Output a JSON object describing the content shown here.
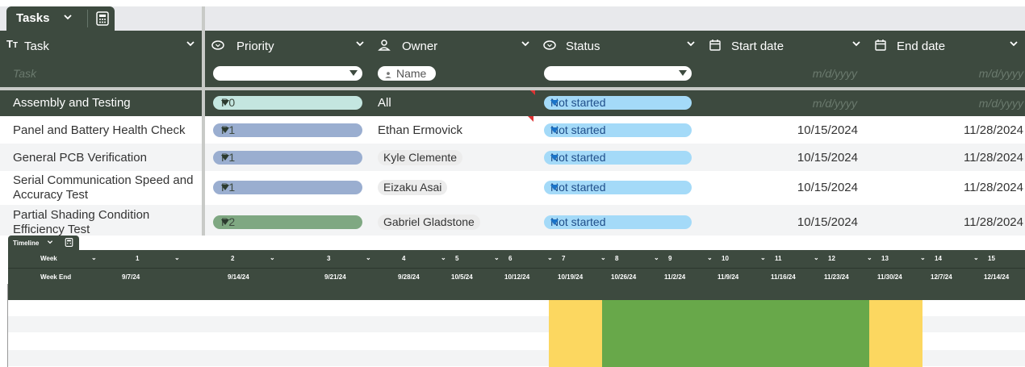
{
  "sheet_tab": {
    "label": "Tasks"
  },
  "columns": [
    {
      "name": "Task",
      "icon": "text-type-icon"
    },
    {
      "name": "Priority",
      "icon": "dropdown-circle-icon"
    },
    {
      "name": "Owner",
      "icon": "person-icon"
    },
    {
      "name": "Status",
      "icon": "dropdown-circle-icon"
    },
    {
      "name": "Start date",
      "icon": "calendar-icon"
    },
    {
      "name": "End date",
      "icon": "calendar-icon"
    }
  ],
  "filter": {
    "task_placeholder": "Task",
    "owner_placeholder": "Name",
    "start_placeholder": "m/d/yyyy",
    "end_placeholder": "m/d/yyyy"
  },
  "group_row": {
    "task": "Assembly and Testing",
    "priority": "P0",
    "owner": "All",
    "status": "Not started",
    "start": "m/d/yyyy",
    "end": "m/d/yyyy"
  },
  "rows": [
    {
      "task": "Panel and Battery Health Check",
      "priority": "P1",
      "owner": "Ethan Ermovick",
      "status": "Not started",
      "start": "10/15/2024",
      "end": "11/28/2024"
    },
    {
      "task": "General PCB Verification",
      "priority": "P1",
      "owner": "Kyle Clemente",
      "status": "Not started",
      "start": "10/15/2024",
      "end": "11/28/2024"
    },
    {
      "task_line1": "Serial Communication Speed and",
      "task_line2": "Accuracy Test",
      "priority": "P1",
      "owner": "Eizaku Asai",
      "status": "Not started",
      "start": "10/15/2024",
      "end": "11/28/2024"
    },
    {
      "task_line1": "Partial Shading Condition",
      "task_line2": "Efficiency Test",
      "priority": "P2",
      "owner": "Gabriel Gladstone",
      "status": "Not started",
      "start": "10/15/2024",
      "end": "11/28/2024"
    }
  ],
  "colors": {
    "header_bg": "#3d4a3f",
    "p0": "#c4e6e0",
    "p1": "#9aaed0",
    "p2": "#7fa882",
    "status": "#a4daf8",
    "gantt_yellow": "#fcd760",
    "gantt_green": "#68a84a"
  },
  "timeline": {
    "tab_label": "Timeline",
    "week_label": "Week",
    "week_end_label": "Week End",
    "weeks": [
      "1",
      "2",
      "3",
      "4",
      "5",
      "6",
      "7",
      "8",
      "9",
      "10",
      "11",
      "12",
      "13",
      "14",
      "15"
    ],
    "week_ends": [
      "9/7/24",
      "9/14/24",
      "9/21/24",
      "9/28/24",
      "10/5/24",
      "10/12/24",
      "10/19/24",
      "10/26/24",
      "11/2/24",
      "11/9/24",
      "11/16/24",
      "11/23/24",
      "11/30/24",
      "12/7/24",
      "12/14/24"
    ]
  }
}
